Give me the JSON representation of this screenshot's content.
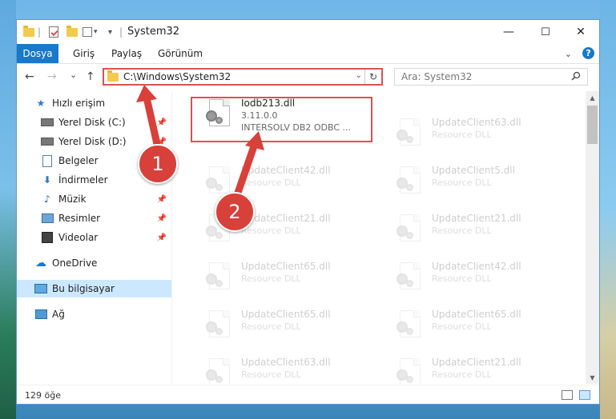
{
  "window": {
    "title": "System32",
    "controls": {
      "minimize": "—",
      "maximize": "☐",
      "close": "✕"
    }
  },
  "ribbon": {
    "file_tab": "Dosya",
    "tabs": [
      "Giriş",
      "Paylaş",
      "Görünüm"
    ],
    "help": "?"
  },
  "nav": {
    "back": "←",
    "forward": "→",
    "recent": "⌄",
    "up": "↑"
  },
  "address": {
    "path": "C:\\Windows\\System32",
    "dropdown": "⌄",
    "refresh": "↻"
  },
  "search": {
    "placeholder": "Ara: System32",
    "icon": "search-icon"
  },
  "sidebar": {
    "items": [
      {
        "label": "Hızlı erişim",
        "icon": "star-icon",
        "pinned": false
      },
      {
        "label": "Yerel Disk (C:)",
        "icon": "drive-icon",
        "pinned": true
      },
      {
        "label": "Yerel Disk (D:)",
        "icon": "drive-icon",
        "pinned": true
      },
      {
        "label": "Belgeler",
        "icon": "document-icon",
        "pinned": true
      },
      {
        "label": "İndirmeler",
        "icon": "download-icon",
        "pinned": true
      },
      {
        "label": "Müzik",
        "icon": "music-icon",
        "pinned": true
      },
      {
        "label": "Resimler",
        "icon": "pictures-icon",
        "pinned": true
      },
      {
        "label": "Videolar",
        "icon": "video-icon",
        "pinned": true
      },
      {
        "label": "OneDrive",
        "icon": "cloud-icon",
        "pinned": false
      },
      {
        "label": "Bu bilgisayar",
        "icon": "computer-icon",
        "pinned": false,
        "selected": true
      },
      {
        "label": "Ağ",
        "icon": "network-icon",
        "pinned": false
      }
    ]
  },
  "files": {
    "highlighted": {
      "name": "Iodb213.dll",
      "version": "3.11.0.0",
      "description": "INTERSOLV DB2 ODBC ..."
    },
    "left_column": [
      {
        "name": "UpdateClient42.dll",
        "type": "Resource DLL"
      },
      {
        "name": "UpdateClient21.dll",
        "type": "Resource DLL"
      },
      {
        "name": "UpdateClient65.dll",
        "type": "Resource DLL"
      },
      {
        "name": "UpdateClient65.dll",
        "type": "Resource DLL"
      },
      {
        "name": "UpdateClient63.dll",
        "type": "Resource DLL"
      }
    ],
    "right_column": [
      {
        "name": "UpdateClient63.dll",
        "type": "Resource DLL"
      },
      {
        "name": "UpdateClient5.dll",
        "type": "Resource DLL"
      },
      {
        "name": "UpdateClient21.dll",
        "type": "Resource DLL"
      },
      {
        "name": "UpdateClient42.dll",
        "type": "Resource DLL"
      },
      {
        "name": "UpdateClient65.dll",
        "type": "Resource DLL"
      },
      {
        "name": "UpdateClient21.dll",
        "type": "Resource DLL"
      }
    ]
  },
  "status": {
    "count": "129 öğe"
  },
  "annotations": {
    "step1": "1",
    "step2": "2",
    "color": "#d8403a"
  }
}
